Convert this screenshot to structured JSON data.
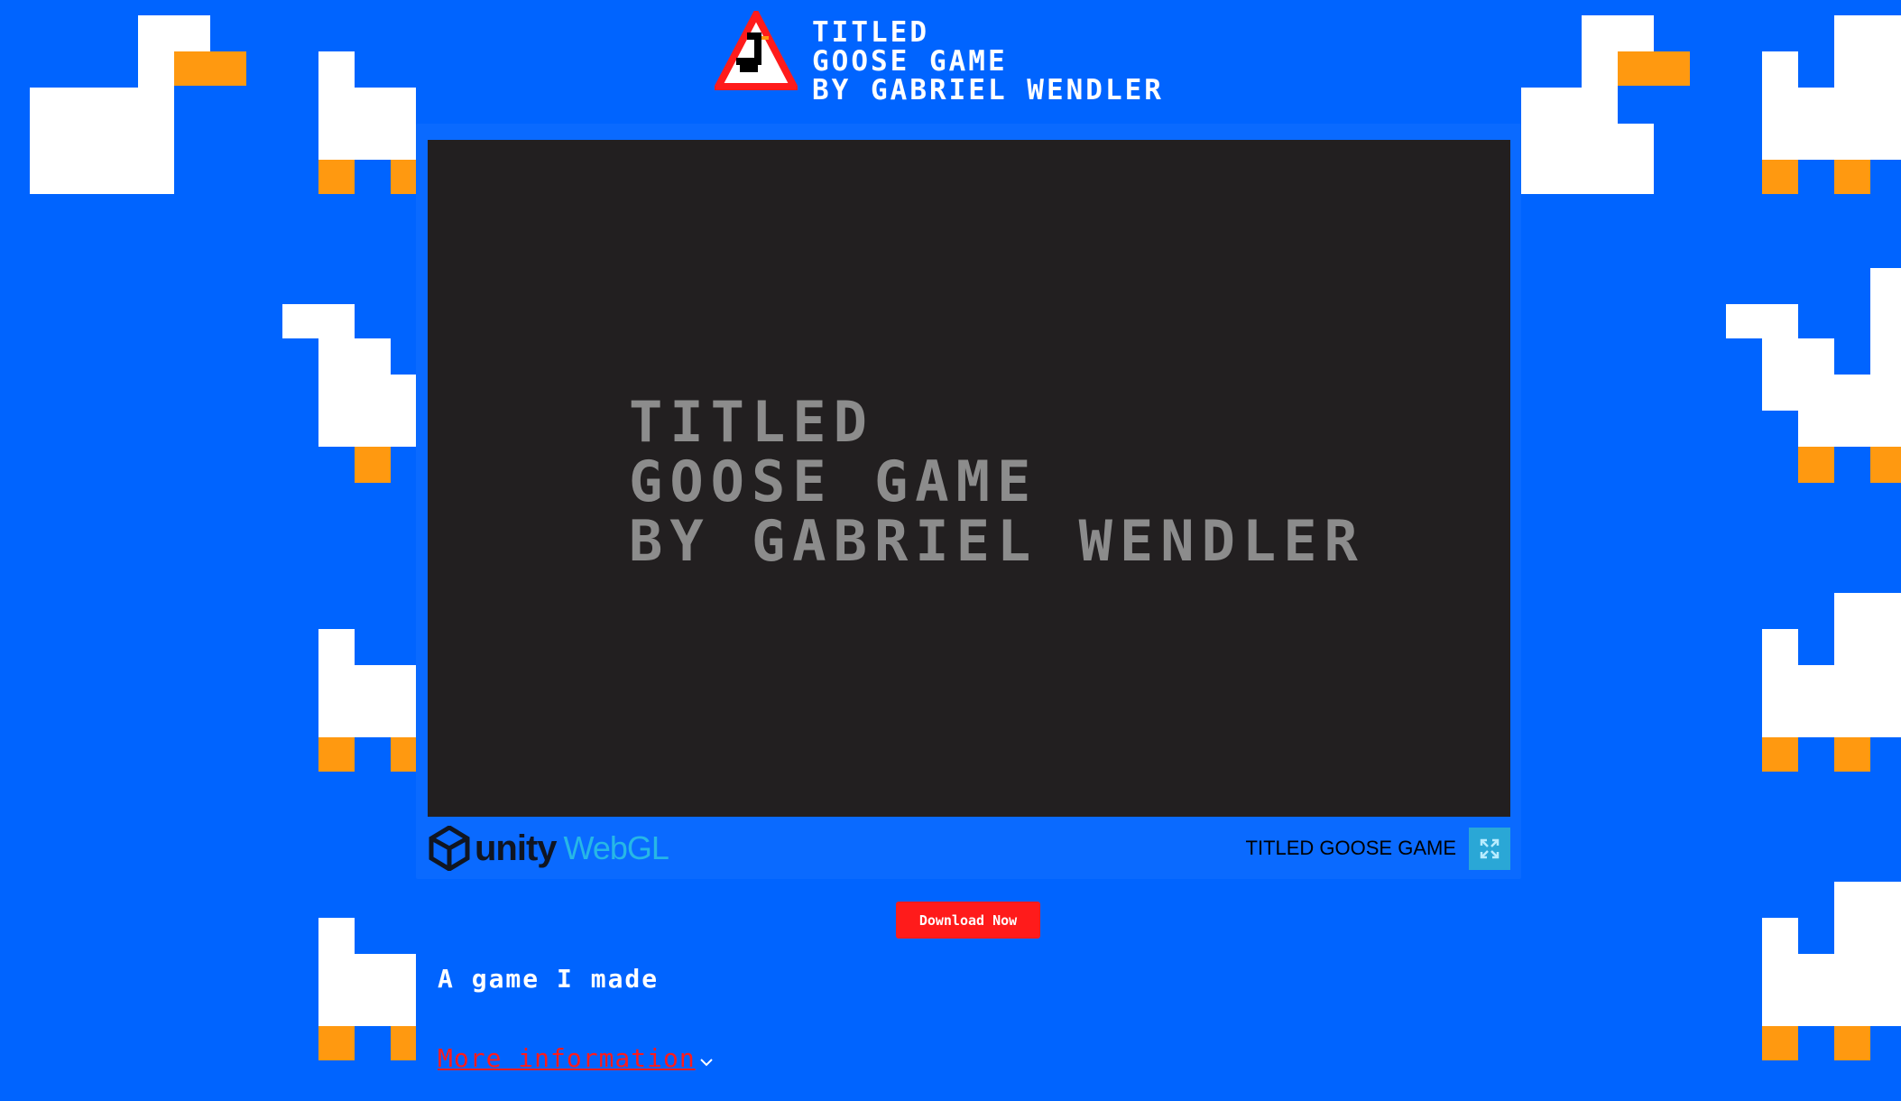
{
  "header": {
    "title_lines": [
      "TITLED",
      "GOOSE GAME",
      "BY GABRIEL WENDLER"
    ]
  },
  "game": {
    "canvas_title_lines": [
      "TITLED",
      "GOOSE GAME",
      "BY GABRIEL WENDLER"
    ],
    "engine_word": "unity",
    "platform_word": "WebGL",
    "game_name": "TITLED GOOSE GAME"
  },
  "download": {
    "label": "Download Now"
  },
  "description": "A game I made",
  "more_info": {
    "label": "More information"
  },
  "colors": {
    "background": "#0064ff",
    "frame": "#0a6aff",
    "canvas": "#221f20",
    "accent_red": "#ff1b1b",
    "goose_white": "#ffffff",
    "goose_orange": "#ff9910",
    "fullscreen": "#2aa7d6"
  },
  "icons": [
    "goose-warning-sign-icon",
    "unity-logo-icon",
    "fullscreen-icon",
    "chevron-down-icon",
    "goose-pattern"
  ]
}
